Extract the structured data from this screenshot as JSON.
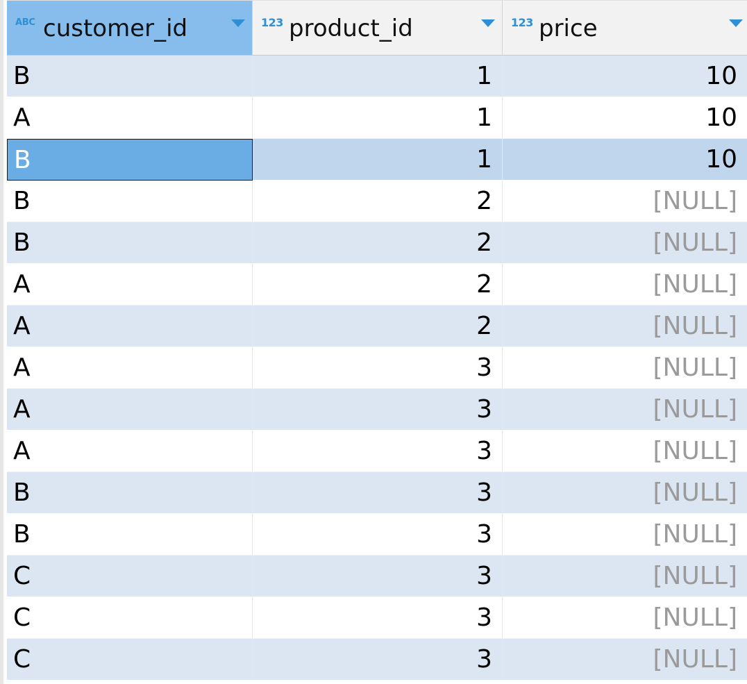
{
  "columns": [
    {
      "label": "customer_id",
      "type_badge": "ABC"
    },
    {
      "label": "product_id",
      "type_badge": "123"
    },
    {
      "label": "price",
      "type_badge": "123"
    }
  ],
  "rows": [
    {
      "customer_id": "B",
      "product_id": "1",
      "price": "10",
      "price_null": false
    },
    {
      "customer_id": "A",
      "product_id": "1",
      "price": "10",
      "price_null": false
    },
    {
      "customer_id": "B",
      "product_id": "1",
      "price": "10",
      "price_null": false,
      "selected": true
    },
    {
      "customer_id": "B",
      "product_id": "2",
      "price": "[NULL]",
      "price_null": true
    },
    {
      "customer_id": "B",
      "product_id": "2",
      "price": "[NULL]",
      "price_null": true
    },
    {
      "customer_id": "A",
      "product_id": "2",
      "price": "[NULL]",
      "price_null": true
    },
    {
      "customer_id": "A",
      "product_id": "2",
      "price": "[NULL]",
      "price_null": true
    },
    {
      "customer_id": "A",
      "product_id": "3",
      "price": "[NULL]",
      "price_null": true
    },
    {
      "customer_id": "A",
      "product_id": "3",
      "price": "[NULL]",
      "price_null": true
    },
    {
      "customer_id": "A",
      "product_id": "3",
      "price": "[NULL]",
      "price_null": true
    },
    {
      "customer_id": "B",
      "product_id": "3",
      "price": "[NULL]",
      "price_null": true
    },
    {
      "customer_id": "B",
      "product_id": "3",
      "price": "[NULL]",
      "price_null": true
    },
    {
      "customer_id": "C",
      "product_id": "3",
      "price": "[NULL]",
      "price_null": true
    },
    {
      "customer_id": "C",
      "product_id": "3",
      "price": "[NULL]",
      "price_null": true
    },
    {
      "customer_id": "C",
      "product_id": "3",
      "price": "[NULL]",
      "price_null": true
    }
  ],
  "colors": {
    "header_selected": "#87bdec",
    "row_stripe": "#dce6f2",
    "row_selected": "#c0d6ec",
    "cell_focused": "#6aade4",
    "null_text": "#9a9a9a",
    "type_icon": "#2f8fd6"
  }
}
